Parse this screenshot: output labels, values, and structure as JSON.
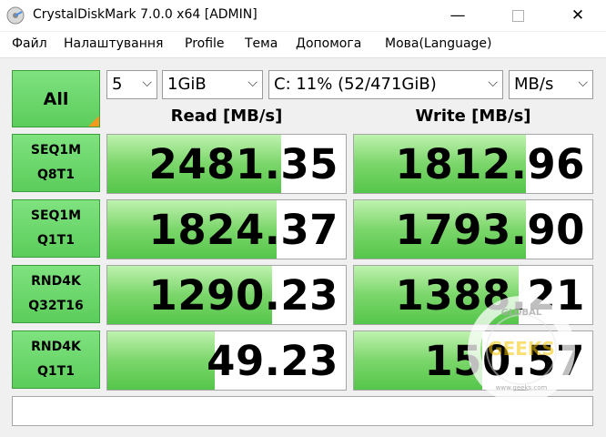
{
  "window": {
    "title": "CrystalDiskMark 7.0.0 x64 [ADMIN]"
  },
  "menu": [
    "Файл",
    "Налаштування",
    "Profile",
    "Тема",
    "Допомога",
    "Мова(Language)"
  ],
  "controls": {
    "all_label": "All",
    "count": "5",
    "size": "1GiB",
    "drive": "C: 11% (52/471GiB)",
    "unit": "MB/s"
  },
  "headers": {
    "read": "Read [MB/s]",
    "write": "Write [MB/s]"
  },
  "tests": [
    {
      "line1": "SEQ1M",
      "line2": "Q8T1",
      "read": "2481.35",
      "write": "1812.96",
      "read_fill": 0.73,
      "write_fill": 0.72
    },
    {
      "line1": "SEQ1M",
      "line2": "Q1T1",
      "read": "1824.37",
      "write": "1793.90",
      "read_fill": 0.71,
      "write_fill": 0.72
    },
    {
      "line1": "RND4K",
      "line2": "Q32T16",
      "read": "1290.23",
      "write": "1388.21",
      "read_fill": 0.69,
      "write_fill": 0.69
    },
    {
      "line1": "RND4K",
      "line2": "Q1T1",
      "read": "49.23",
      "write": "150.57",
      "read_fill": 0.45,
      "write_fill": 0.54
    }
  ],
  "status_text": "",
  "watermark": {
    "top": "GLOBAL",
    "center": "GEEKS",
    "bottom": "www.geeks.com"
  },
  "colors": {
    "green": "#5bcd5b",
    "orange": "#f39a1e"
  }
}
